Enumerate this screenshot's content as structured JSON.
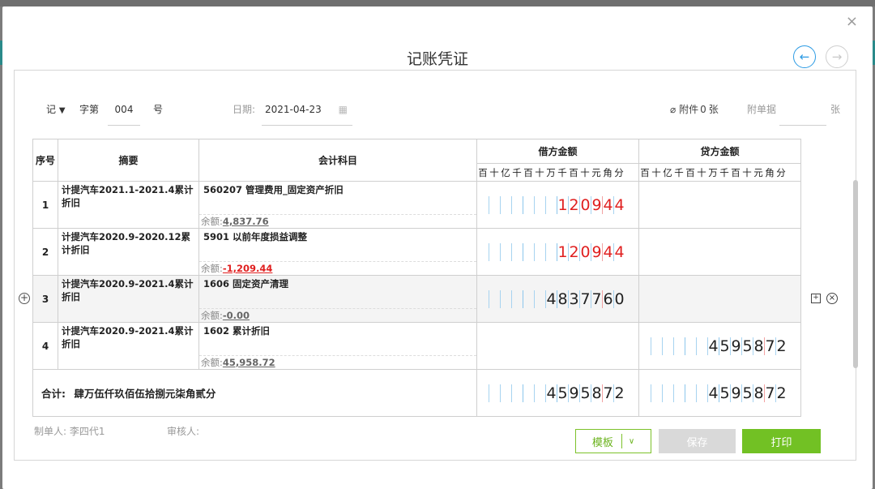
{
  "dialog": {
    "title": "记账凭证",
    "close": "×",
    "prev": "←",
    "next": "→"
  },
  "header": {
    "voucher_word": "记",
    "word_label": "字第",
    "number": "004",
    "hao": "号",
    "date_label": "日期:",
    "date": "2021-04-23",
    "attachment_label": "附件",
    "attachment_count": "0",
    "attachment_unit": "张",
    "doc_label": "附单据",
    "doc_unit": "张"
  },
  "table": {
    "headers": {
      "index": "序号",
      "summary": "摘要",
      "account": "会计科目",
      "debit": "借方金额",
      "credit": "贷方金额"
    },
    "digit_units": [
      "百",
      "十",
      "亿",
      "千",
      "百",
      "十",
      "万",
      "千",
      "百",
      "十",
      "元",
      "角",
      "分"
    ],
    "balance_label": "余额:",
    "rows": [
      {
        "index": "1",
        "summary": "计提汽车2021.1-2021.4累计折旧",
        "account": "560207 管理费用_固定资产折旧",
        "balance": "4,837.76",
        "balance_negative": false,
        "debit": "120944",
        "debit_color": "#e02020",
        "credit": "",
        "credit_color": "#222222"
      },
      {
        "index": "2",
        "summary": "计提汽车2020.9-2020.12累计折旧",
        "account": "5901 以前年度损益调整",
        "balance": "-1,209.44",
        "balance_negative": true,
        "debit": "120944",
        "debit_color": "#e02020",
        "credit": "",
        "credit_color": "#222222"
      },
      {
        "index": "3",
        "summary": "计提汽车2020.9-2021.4累计折旧",
        "account": "1606 固定资产清理",
        "balance": "-0.00",
        "balance_negative": false,
        "debit": "4837760",
        "debit_color": "#222222",
        "credit": "",
        "credit_color": "#222222"
      },
      {
        "index": "4",
        "summary": "计提汽车2020.9-2021.4累计折旧",
        "account": "1602 累计折旧",
        "balance": "45,958.72",
        "balance_negative": false,
        "debit": "",
        "debit_color": "#222222",
        "credit": "4595872",
        "credit_color": "#222222"
      }
    ],
    "total": {
      "label": "合计:",
      "text": "肆万伍仟玖佰伍拾捌元柒角贰分",
      "debit": "4595872",
      "credit": "4595872"
    }
  },
  "footer": {
    "maker_label": "制单人:",
    "maker": "李四代1",
    "reviewer_label": "审核人:",
    "reviewer": ""
  },
  "buttons": {
    "template": "模板",
    "save": "保存",
    "print": "打印"
  },
  "colors": {
    "accent_green": "#72c124",
    "nav_blue": "#2c9be4",
    "amount_red": "#e02020"
  }
}
